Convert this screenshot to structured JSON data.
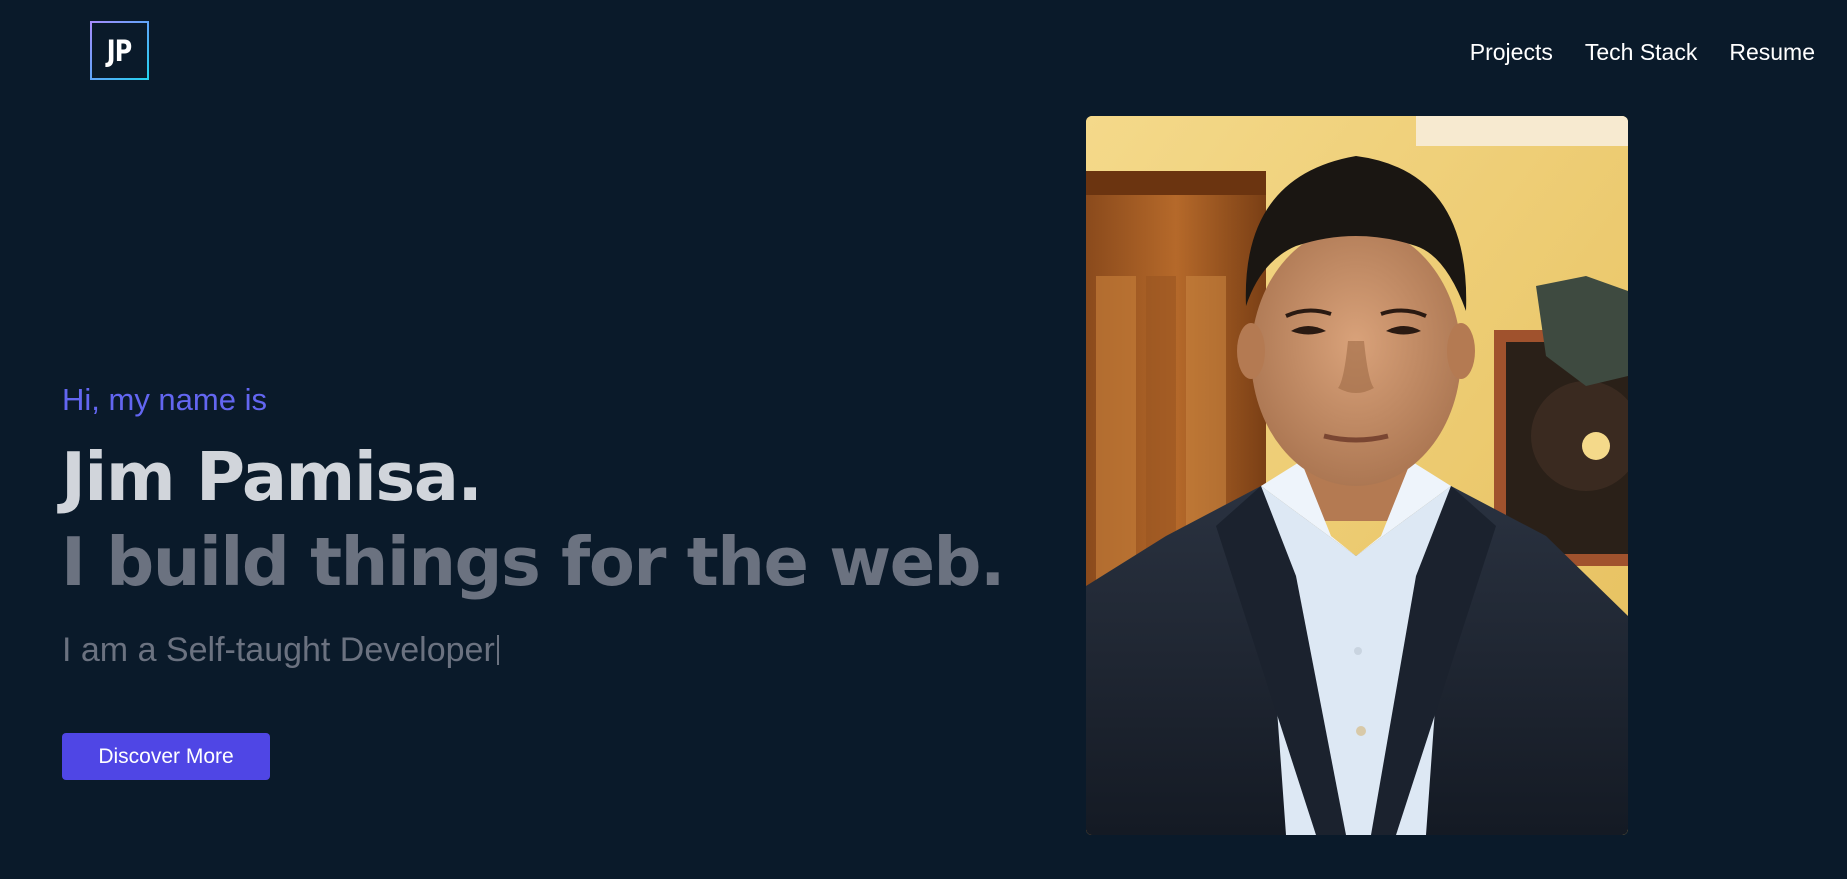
{
  "header": {
    "logo_text": "JP",
    "nav": [
      "Projects",
      "Tech Stack",
      "Resume"
    ]
  },
  "hero": {
    "greeting": "Hi, my name is",
    "name": "Jim Pamisa.",
    "tagline": "I build things for the web.",
    "subtitle": "I am a Self-taught Developer",
    "cta_label": "Discover More"
  },
  "colors": {
    "background": "#0a1a2a",
    "accent": "#4f46e5",
    "greeting": "#6366f1",
    "name": "#d1d5db",
    "muted": "#6b7280"
  },
  "icons": [
    "logo-icon"
  ]
}
